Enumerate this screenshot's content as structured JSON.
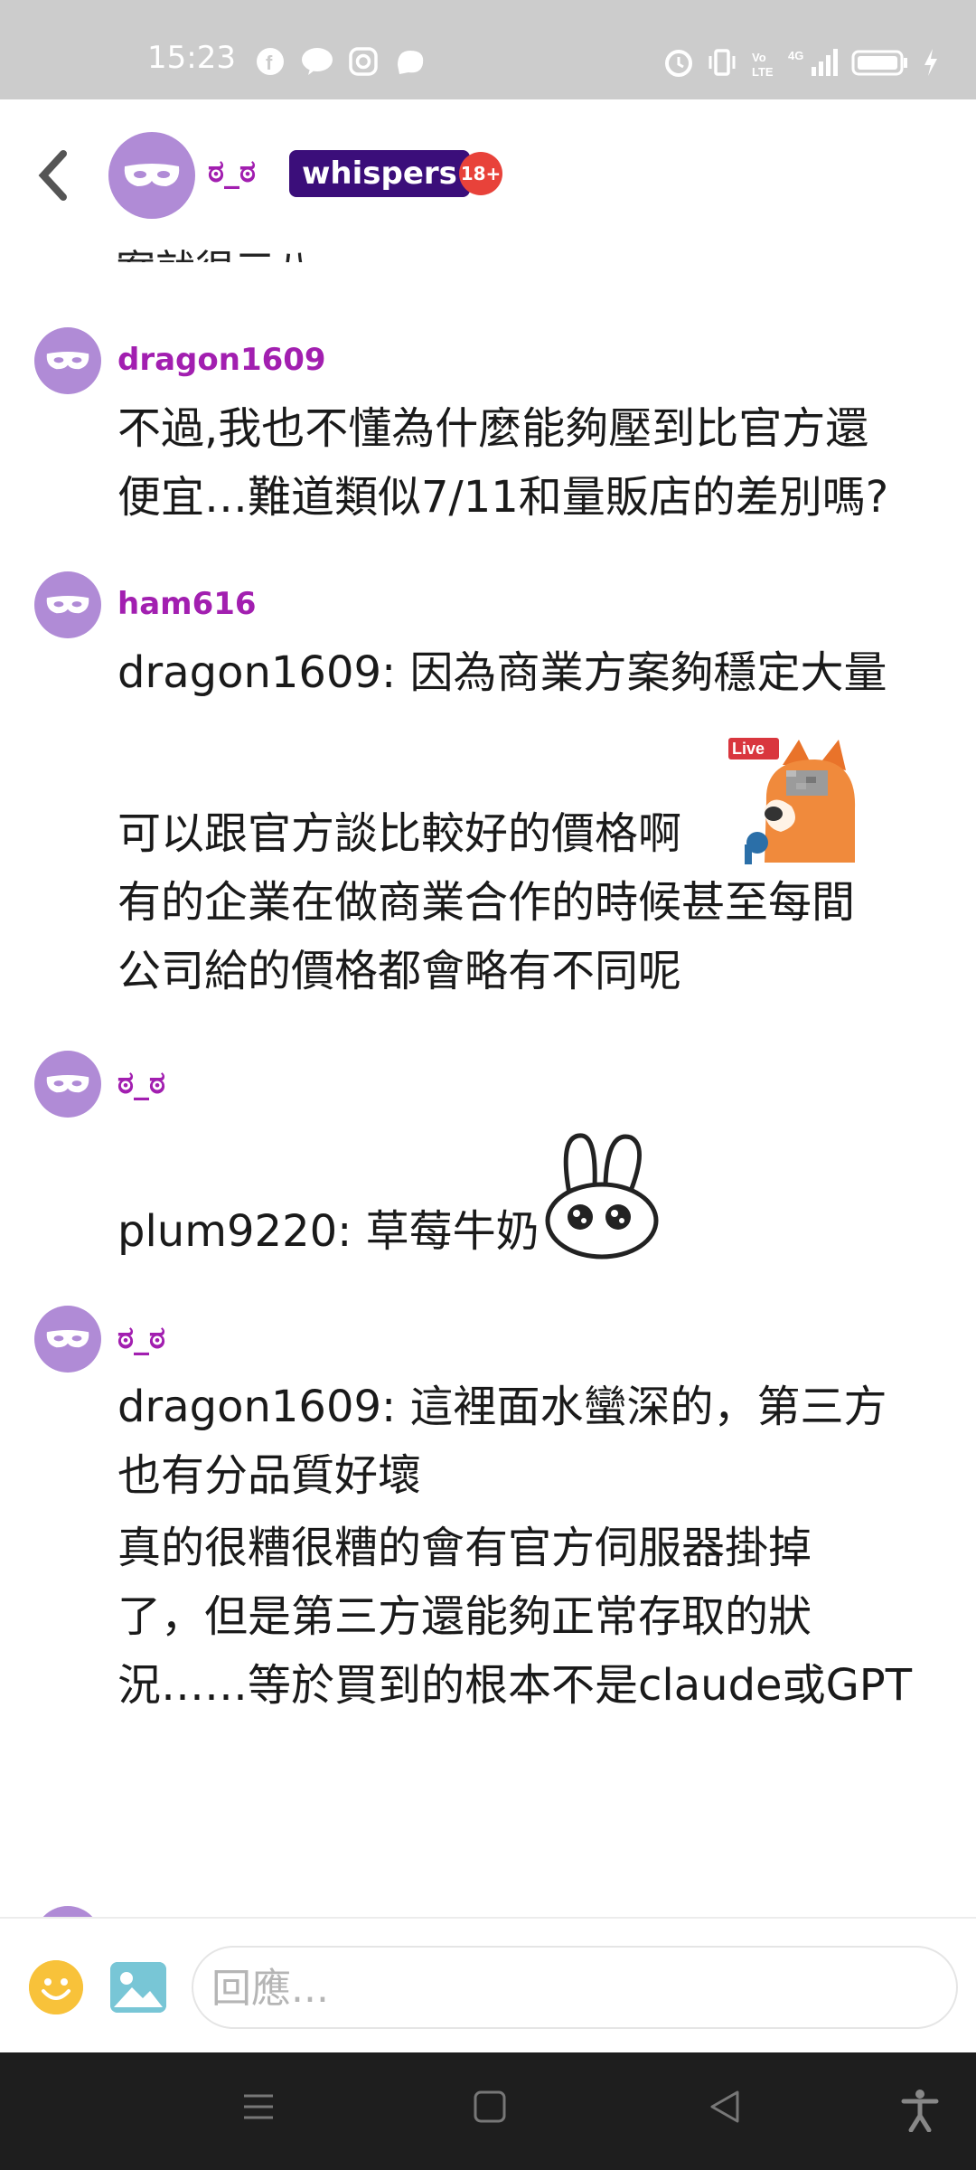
{
  "status_bar": {
    "time": "15:23",
    "left_icons": [
      "facebook-icon",
      "line-icon",
      "instagram-icon",
      "app-icon"
    ],
    "right_icons": [
      "alarm-icon",
      "vibrate-icon",
      "volte-icon",
      "signal-4g-icon",
      "battery-icon",
      "charging-icon"
    ]
  },
  "header": {
    "name": "ಠ_ಠ",
    "badge": "whispers",
    "age_badge": "18+"
  },
  "chat": {
    "partial_top_text": "案就很三八",
    "messages": [
      {
        "user": "dragon1609",
        "lines": [
          "不過,我也不懂為什麼能夠壓到比官方還",
          "便宜…難道類似7/11和量販店的差別嗎?"
        ]
      },
      {
        "user": "ham616",
        "lines": [
          "dragon1609: 因為商業方案夠穩定大量",
          "可以跟官方談比較好的價格啊",
          "有的企業在做商業合作的時候甚至每間",
          "公司給的價格都會略有不同呢"
        ],
        "sticker_label": "Live"
      },
      {
        "user": "ಠ_ಠ",
        "lines": [
          "plum9220: 草莓牛奶"
        ]
      },
      {
        "user": "ಠ_ಠ",
        "lines": [
          "dragon1609: 這裡面水蠻深的，第三方",
          "也有分品質好壞",
          "真的很糟很糟的會有官方伺服器掛掉",
          "了，但是第三方還能夠正常存取的狀",
          "況……等於買到的根本不是claude或GPT"
        ]
      }
    ]
  },
  "input": {
    "placeholder": "回應..."
  },
  "colors": {
    "username": "#a21fb0",
    "avatar": "#b08bd6",
    "whispers_badge": "#3b0e7a",
    "age_badge": "#e8423a"
  }
}
